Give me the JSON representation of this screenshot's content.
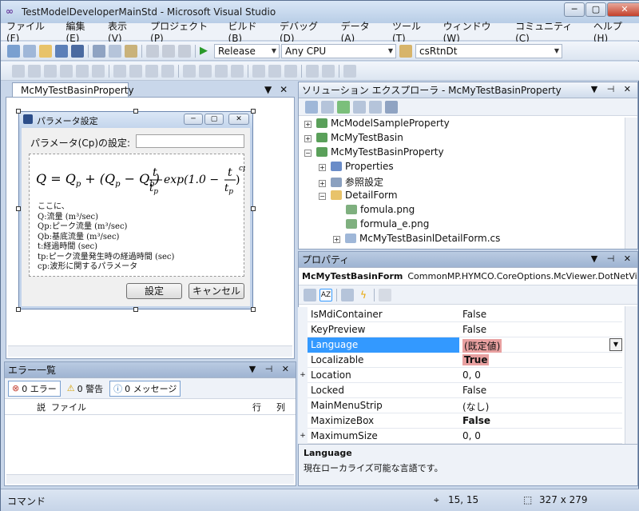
{
  "window": {
    "title": "TestModelDeveloperMainStd - Microsoft Visual Studio",
    "min": "─",
    "max": "▢",
    "close": "✕"
  },
  "menu": [
    "ファイル(F)",
    "編集(E)",
    "表示(V)",
    "プロジェクト(P)",
    "ビルド(B)",
    "デバッグ(D)",
    "データ(A)",
    "ツール(T)",
    "ウィンドウ(W)",
    "コミュニティ(C)",
    "ヘルプ(H)"
  ],
  "toolbar": {
    "config": "Release",
    "platform": "Any CPU",
    "find": "csRtnDt"
  },
  "designer": {
    "tab": "McMyTestBasinProperty",
    "form": {
      "title": "パラメータ設定",
      "param_label": "パラメータ(Cp)の設定:",
      "ok": "設定",
      "cancel": "キャンセル"
    },
    "formula": {
      "lines": [
        "ここに、",
        "Q:流量 (m³/sec)",
        "Qp:ピーク流量 (m³/sec)",
        "Qb:基底流量 (m³/sec)",
        "t:経過時間 (sec)",
        "tp:ピーク流量発生時の経過時間 (sec)",
        "cp:波形に関するパラメータ"
      ]
    }
  },
  "solution": {
    "title": "ソリューション エクスプローラ - McMyTestBasinProperty",
    "items": [
      {
        "label": "McModelSampleProperty",
        "exp": "+"
      },
      {
        "label": "McMyTestBasin",
        "exp": "+"
      },
      {
        "label": "McMyTestBasinProperty",
        "exp": "−"
      },
      {
        "label": "Properties",
        "exp": "+"
      },
      {
        "label": "参照設定",
        "exp": "+"
      },
      {
        "label": "DetailForm",
        "exp": "−"
      },
      {
        "label": "fomula.png",
        "exp": ""
      },
      {
        "label": "formula_e.png",
        "exp": ""
      },
      {
        "label": "McMyTestBasinlDetailForm.cs",
        "exp": "+"
      }
    ]
  },
  "properties": {
    "title": "プロパティ",
    "object": "McMyTestBasinForm",
    "object_type": "CommonMP.HYMCO.CoreOptions.McViewer.DotNetVie",
    "rows": [
      {
        "name": "IsMdiContainer",
        "value": "False",
        "exp": ""
      },
      {
        "name": "KeyPreview",
        "value": "False",
        "exp": ""
      },
      {
        "name": "Language",
        "value": "(既定値)",
        "exp": ""
      },
      {
        "name": "Localizable",
        "value": "True",
        "exp": ""
      },
      {
        "name": "Location",
        "value": "0, 0",
        "exp": "+"
      },
      {
        "name": "Locked",
        "value": "False",
        "exp": ""
      },
      {
        "name": "MainMenuStrip",
        "value": "(なし)",
        "exp": ""
      },
      {
        "name": "MaximizeBox",
        "value": "False",
        "exp": ""
      },
      {
        "name": "MaximumSize",
        "value": "0, 0",
        "exp": "+"
      }
    ],
    "desc_title": "Language",
    "desc_text": "現在ローカライズ可能な言語です。"
  },
  "errors": {
    "title": "エラー一覧",
    "errors_btn": "0 エラー",
    "warnings_btn": "0 警告",
    "messages_btn": "0 メッセージ",
    "col_desc": "説",
    "col_file": "ファイル",
    "col_line": "行",
    "col_col": "列"
  },
  "status": {
    "text": "コマンド",
    "position": "15, 15",
    "size": "327 x 279"
  },
  "colors": {
    "accent": "#3399ff",
    "changed": "#e8a0a0"
  }
}
